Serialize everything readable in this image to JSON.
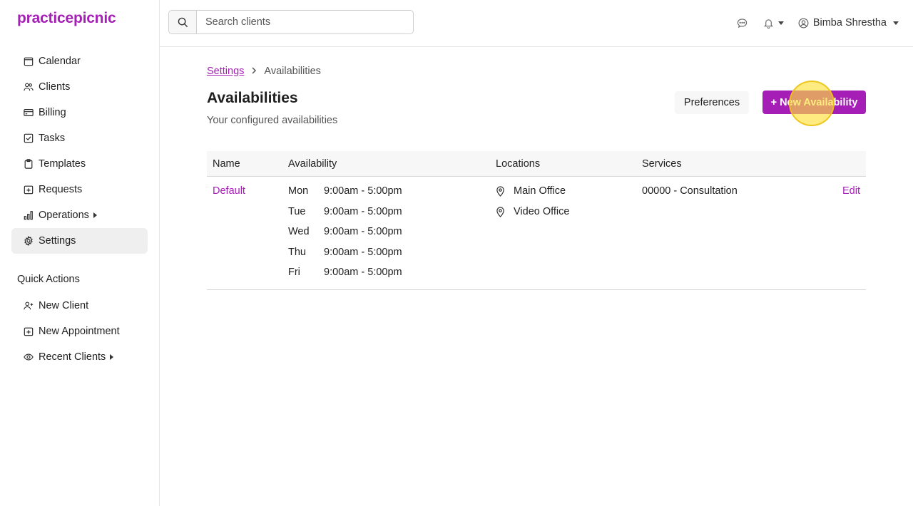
{
  "app": {
    "logo": "practicepicnic",
    "brand_color": "#a51fb6"
  },
  "sidebar": {
    "items": [
      {
        "label": "Calendar",
        "icon": "calendar-icon"
      },
      {
        "label": "Clients",
        "icon": "users-icon"
      },
      {
        "label": "Billing",
        "icon": "credit-card-icon"
      },
      {
        "label": "Tasks",
        "icon": "checkbox-icon"
      },
      {
        "label": "Templates",
        "icon": "clipboard-icon"
      },
      {
        "label": "Requests",
        "icon": "plus-square-icon"
      },
      {
        "label": "Operations",
        "icon": "bar-chart-icon"
      },
      {
        "label": "Settings",
        "icon": "gear-icon",
        "active": true
      }
    ],
    "quick_actions_title": "Quick Actions",
    "quick_actions": [
      {
        "label": "New Client",
        "icon": "user-plus-icon"
      },
      {
        "label": "New Appointment",
        "icon": "calendar-plus-icon"
      },
      {
        "label": "Recent Clients",
        "icon": "eye-icon"
      }
    ]
  },
  "topbar": {
    "search_placeholder": "Search clients",
    "user_name": "Bimba Shrestha"
  },
  "page": {
    "breadcrumb_parent": "Settings",
    "breadcrumb_current": "Availabilities",
    "title": "Availabilities",
    "subtitle": "Your configured availabilities",
    "preferences_label": "Preferences",
    "new_label": "+ New Availability"
  },
  "table": {
    "headers": {
      "name": "Name",
      "availability": "Availability",
      "locations": "Locations",
      "services": "Services"
    },
    "rows": [
      {
        "name": "Default",
        "days": [
          {
            "day": "Mon",
            "time": "9:00am - 5:00pm"
          },
          {
            "day": "Tue",
            "time": "9:00am - 5:00pm"
          },
          {
            "day": "Wed",
            "time": "9:00am - 5:00pm"
          },
          {
            "day": "Thu",
            "time": "9:00am - 5:00pm"
          },
          {
            "day": "Fri",
            "time": "9:00am - 5:00pm"
          }
        ],
        "locations": [
          "Main Office",
          "Video Office"
        ],
        "services": "00000 - Consultation",
        "edit_label": "Edit"
      }
    ]
  }
}
